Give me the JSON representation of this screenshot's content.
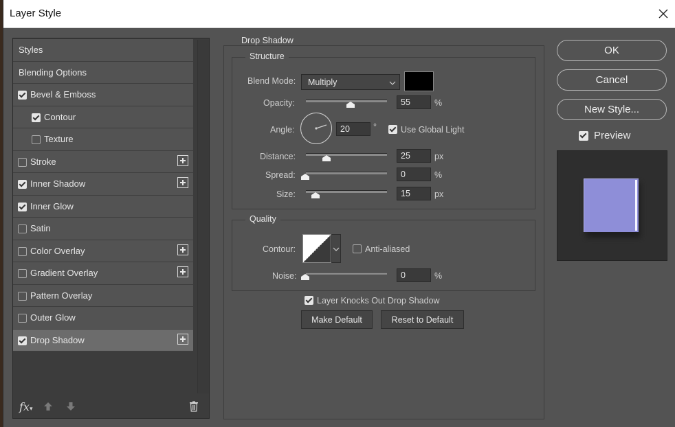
{
  "window": {
    "title": "Layer Style"
  },
  "styles_list": {
    "items": [
      {
        "label": "Styles",
        "checkbox": null,
        "plus": false,
        "selected": false
      },
      {
        "label": "Blending Options",
        "checkbox": null,
        "plus": false,
        "selected": false
      },
      {
        "label": "Bevel & Emboss",
        "checkbox": true,
        "plus": false,
        "selected": false
      },
      {
        "label": "Contour",
        "checkbox": true,
        "plus": false,
        "selected": false
      },
      {
        "label": "Texture",
        "checkbox": false,
        "plus": false,
        "selected": false
      },
      {
        "label": "Stroke",
        "checkbox": false,
        "plus": true,
        "selected": false
      },
      {
        "label": "Inner Shadow",
        "checkbox": true,
        "plus": true,
        "selected": false
      },
      {
        "label": "Inner Glow",
        "checkbox": true,
        "plus": false,
        "selected": false
      },
      {
        "label": "Satin",
        "checkbox": false,
        "plus": false,
        "selected": false
      },
      {
        "label": "Color Overlay",
        "checkbox": false,
        "plus": true,
        "selected": false
      },
      {
        "label": "Gradient Overlay",
        "checkbox": false,
        "plus": true,
        "selected": false
      },
      {
        "label": "Pattern Overlay",
        "checkbox": false,
        "plus": false,
        "selected": false
      },
      {
        "label": "Outer Glow",
        "checkbox": false,
        "plus": false,
        "selected": false
      },
      {
        "label": "Drop Shadow",
        "checkbox": true,
        "plus": true,
        "selected": true
      }
    ],
    "footer_fx": "fx"
  },
  "drop_shadow": {
    "section_title": "Drop Shadow",
    "structure": {
      "title": "Structure",
      "blend_mode_label": "Blend Mode:",
      "blend_mode_value": "Multiply",
      "shadow_color": "#000000",
      "opacity_label": "Opacity:",
      "opacity_value": "55",
      "opacity_unit": "%",
      "angle_label": "Angle:",
      "angle_value": "20",
      "angle_unit": "°",
      "use_global_light_label": "Use Global Light",
      "use_global_light": true,
      "distance_label": "Distance:",
      "distance_value": "25",
      "distance_unit": "px",
      "spread_label": "Spread:",
      "spread_value": "0",
      "spread_unit": "%",
      "size_label": "Size:",
      "size_value": "15",
      "size_unit": "px"
    },
    "quality": {
      "title": "Quality",
      "contour_label": "Contour:",
      "anti_aliased_label": "Anti-aliased",
      "anti_aliased": false,
      "noise_label": "Noise:",
      "noise_value": "0",
      "noise_unit": "%"
    },
    "knockout_label": "Layer Knocks Out Drop Shadow",
    "knockout": true,
    "make_default_label": "Make Default",
    "reset_default_label": "Reset to Default"
  },
  "actions": {
    "ok_label": "OK",
    "cancel_label": "Cancel",
    "new_style_label": "New Style...",
    "preview_label": "Preview",
    "preview_checked": true
  },
  "colors": {
    "panel_bg": "#535353",
    "selected_row": "#6c6c6c",
    "preview_swatch": "#8e8ed8"
  }
}
